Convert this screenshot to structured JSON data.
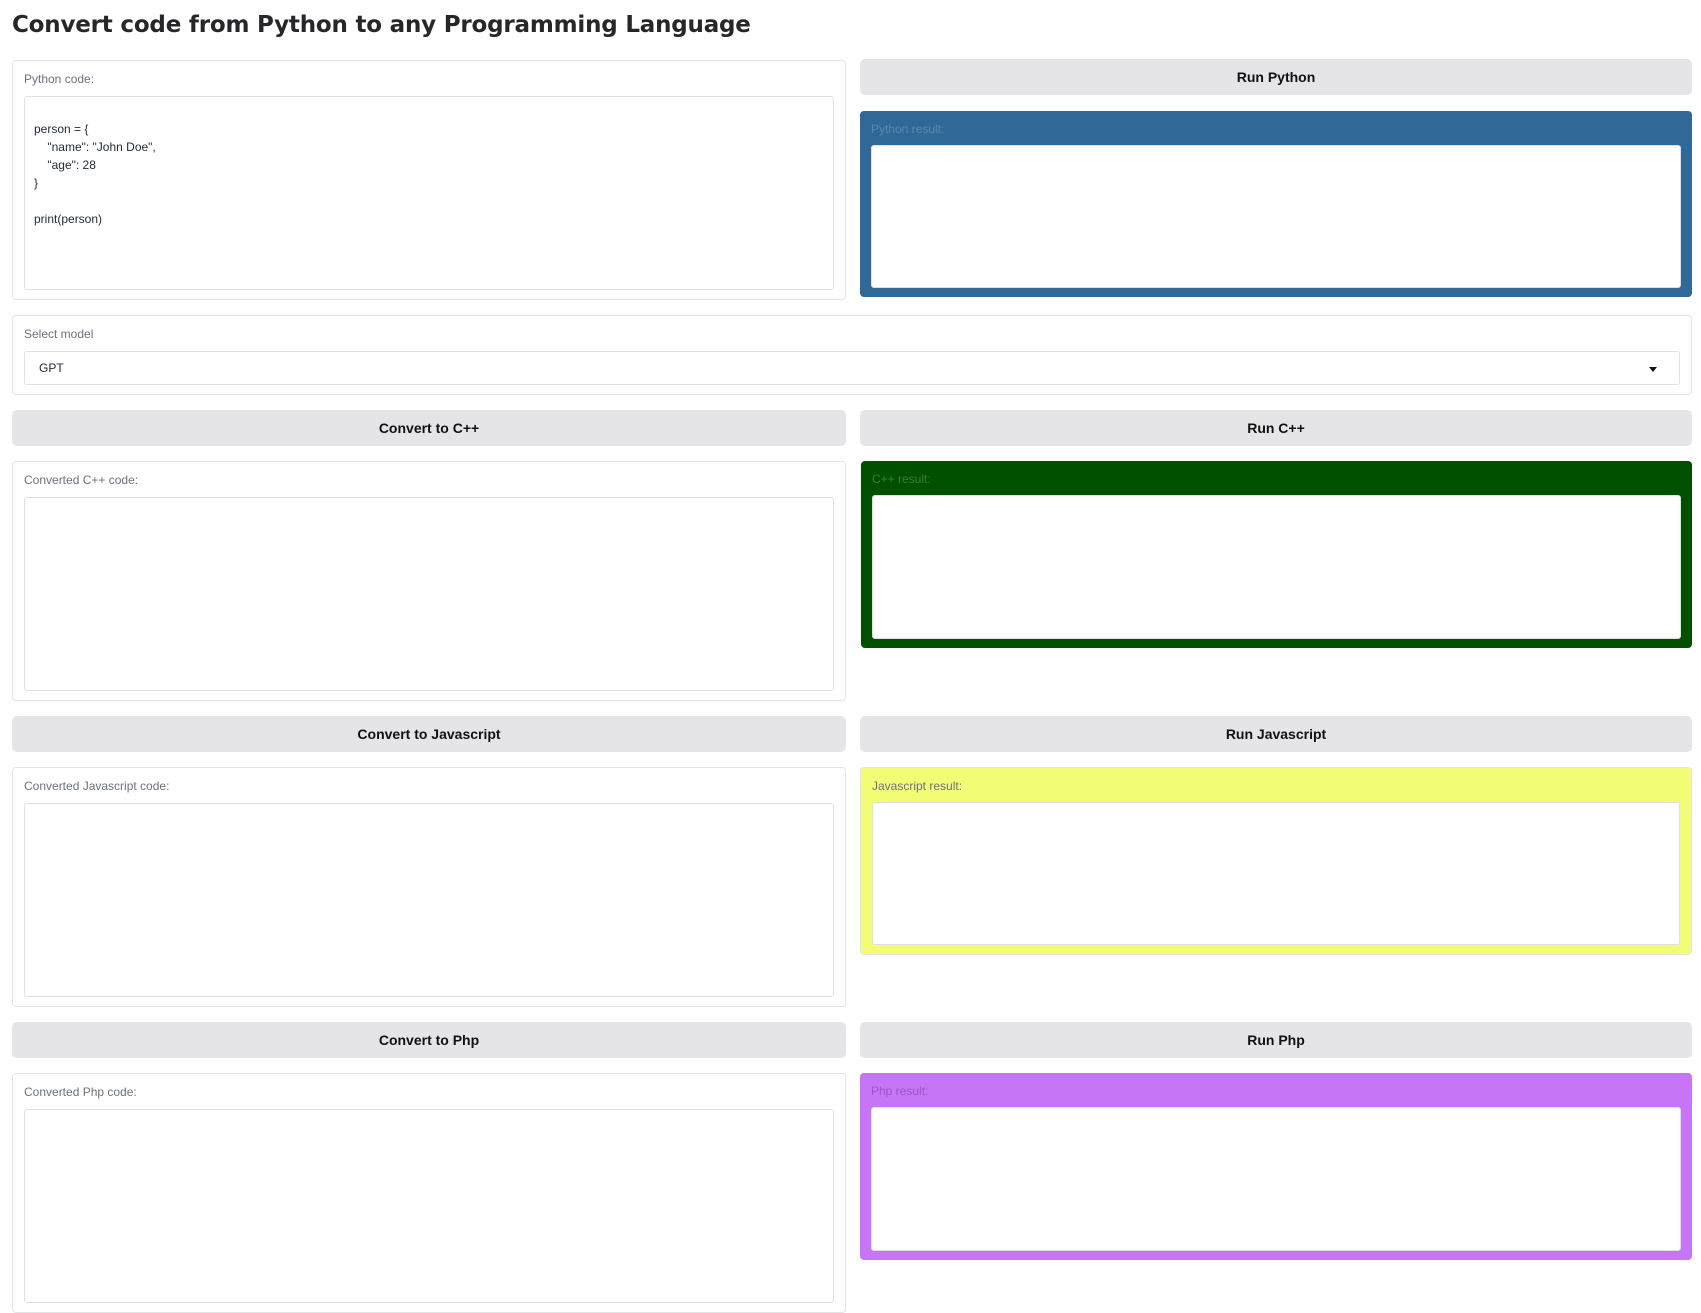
{
  "header": {
    "title": "Convert code from Python to any Programming Language"
  },
  "python": {
    "code_label": "Python code:",
    "code_value": "person = {\n    \"name\": \"John Doe\",\n    \"age\": 28\n}\n\nprint(person)",
    "run_label": "Run Python",
    "result_label": "Python result:",
    "result_bg": "#306998",
    "result_label_color": "#5b86ad"
  },
  "model": {
    "label": "Select model",
    "selected": "GPT"
  },
  "cpp": {
    "convert_label": "Convert to C++",
    "run_label": "Run C++",
    "code_label": "Converted C++ code:",
    "result_label": "C++ result:",
    "result_bg": "#005000",
    "result_label_color": "#3d7a3d"
  },
  "javascript": {
    "convert_label": "Convert to Javascript",
    "run_label": "Run Javascript",
    "code_label": "Converted Javascript code:",
    "result_label": "Javascript result:",
    "result_bg": "#f2fc75",
    "result_label_color": "#6b7280"
  },
  "php": {
    "convert_label": "Convert to Php",
    "run_label": "Run Php",
    "code_label": "Converted Php code:",
    "result_label": "Php result:",
    "result_bg": "#c775f7",
    "result_label_color": "#9a58c6"
  }
}
